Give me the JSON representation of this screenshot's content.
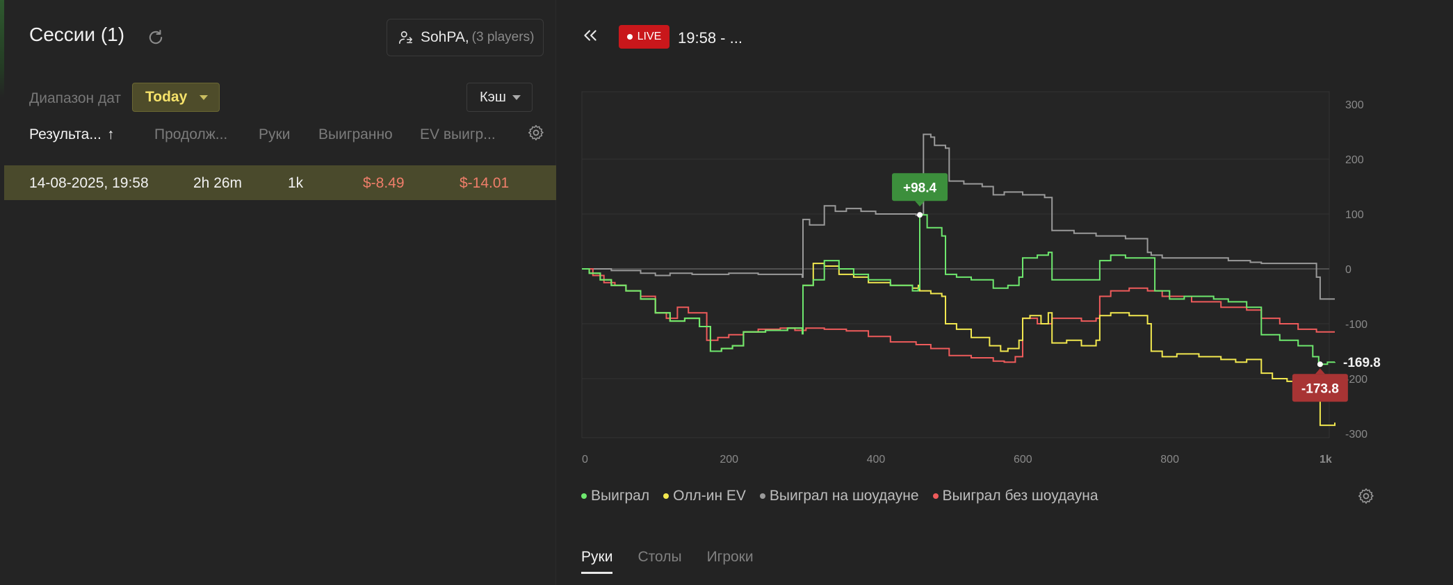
{
  "left_panel": {
    "title": "Сессии (1)",
    "player_name": "SohPA,",
    "player_count": "(3 players)",
    "date_range_label": "Диапазон дат",
    "date_range_value": "Today",
    "game_type": "Кэш",
    "columns": [
      "Результа...",
      "Продолж...",
      "Руки",
      "Выигранно",
      "EV выигр..."
    ],
    "sort_indicator": "↑",
    "rows": [
      {
        "date": "14-08-2025, 19:58",
        "duration": "2h 26m",
        "hands": "1k",
        "won": "$-8.49",
        "ev_won": "$-14.01"
      }
    ]
  },
  "right_panel": {
    "live_label": "LIVE",
    "session_title": "19:58 - ...",
    "legend": [
      {
        "label": "Выиграл",
        "color": "#6ee86e"
      },
      {
        "label": "Олл-ин EV",
        "color": "#f2e84f"
      },
      {
        "label": "Выиграл на шоудауне",
        "color": "#9a9a9a"
      },
      {
        "label": "Выиграл без шоудауна",
        "color": "#ef5b5b"
      }
    ],
    "tabs": [
      "Руки",
      "Столы",
      "Игроки"
    ],
    "active_tab": "Руки"
  },
  "chart_data": {
    "type": "line",
    "xlim": [
      0,
      1025
    ],
    "ylim": [
      -300,
      300
    ],
    "x_ticks": [
      "0",
      "200",
      "400",
      "600",
      "800",
      "1k"
    ],
    "y_ticks": [
      "300",
      "200",
      "100",
      "0",
      "-100",
      "-200",
      "-300"
    ],
    "grid": true,
    "legend_position": "bottom",
    "annotations": [
      {
        "label": "+98.4",
        "x": 460,
        "y": 98.4,
        "color": "#3c8f3c"
      },
      {
        "label": "-173.8",
        "x": 1005,
        "y": -173.8,
        "color": "#a83434"
      },
      {
        "label": "-169.8",
        "x": 1025,
        "y": -169.8,
        "color": "none"
      }
    ],
    "series": [
      {
        "name": "Выиграл",
        "color": "#6ee86e",
        "points": [
          [
            0,
            0
          ],
          [
            10,
            -8
          ],
          [
            25,
            -20
          ],
          [
            40,
            -30
          ],
          [
            60,
            -40
          ],
          [
            80,
            -55
          ],
          [
            100,
            -80
          ],
          [
            120,
            -95
          ],
          [
            140,
            -90
          ],
          [
            160,
            -105
          ],
          [
            175,
            -150
          ],
          [
            190,
            -145
          ],
          [
            205,
            -140
          ],
          [
            220,
            -115
          ],
          [
            250,
            -112
          ],
          [
            280,
            -108
          ],
          [
            300,
            -118
          ],
          [
            301,
            -30
          ],
          [
            315,
            -20
          ],
          [
            330,
            15
          ],
          [
            350,
            0
          ],
          [
            370,
            -10
          ],
          [
            390,
            -20
          ],
          [
            420,
            -30
          ],
          [
            450,
            -40
          ],
          [
            458,
            -35
          ],
          [
            460,
            98.4
          ],
          [
            470,
            75
          ],
          [
            490,
            60
          ],
          [
            495,
            -10
          ],
          [
            510,
            -15
          ],
          [
            530,
            -20
          ],
          [
            560,
            -35
          ],
          [
            580,
            -30
          ],
          [
            595,
            -15
          ],
          [
            600,
            20
          ],
          [
            620,
            25
          ],
          [
            635,
            30
          ],
          [
            640,
            -20
          ],
          [
            670,
            -20
          ],
          [
            700,
            -20
          ],
          [
            705,
            15
          ],
          [
            720,
            25
          ],
          [
            740,
            20
          ],
          [
            770,
            20
          ],
          [
            780,
            -40
          ],
          [
            800,
            -55
          ],
          [
            820,
            -50
          ],
          [
            860,
            -55
          ],
          [
            880,
            -60
          ],
          [
            905,
            -70
          ],
          [
            925,
            -120
          ],
          [
            950,
            -130
          ],
          [
            975,
            -140
          ],
          [
            995,
            -160
          ],
          [
            1003,
            -173.8
          ],
          [
            1015,
            -170
          ],
          [
            1025,
            -169.8
          ]
        ]
      },
      {
        "name": "Олл-ин EV",
        "color": "#f2e84f",
        "points": [
          [
            0,
            0
          ],
          [
            10,
            -8
          ],
          [
            25,
            -20
          ],
          [
            40,
            -30
          ],
          [
            60,
            -40
          ],
          [
            80,
            -55
          ],
          [
            100,
            -80
          ],
          [
            120,
            -95
          ],
          [
            140,
            -90
          ],
          [
            160,
            -105
          ],
          [
            175,
            -150
          ],
          [
            190,
            -145
          ],
          [
            205,
            -140
          ],
          [
            220,
            -115
          ],
          [
            250,
            -112
          ],
          [
            280,
            -108
          ],
          [
            300,
            -118
          ],
          [
            301,
            -30
          ],
          [
            315,
            10
          ],
          [
            330,
            5
          ],
          [
            350,
            -10
          ],
          [
            370,
            -15
          ],
          [
            390,
            -25
          ],
          [
            420,
            -30
          ],
          [
            450,
            -35
          ],
          [
            458,
            -30
          ],
          [
            460,
            -40
          ],
          [
            475,
            -45
          ],
          [
            490,
            -50
          ],
          [
            495,
            -100
          ],
          [
            510,
            -110
          ],
          [
            530,
            -125
          ],
          [
            555,
            -140
          ],
          [
            570,
            -150
          ],
          [
            580,
            -145
          ],
          [
            595,
            -130
          ],
          [
            600,
            -90
          ],
          [
            610,
            -85
          ],
          [
            625,
            -100
          ],
          [
            635,
            -80
          ],
          [
            640,
            -135
          ],
          [
            660,
            -130
          ],
          [
            680,
            -140
          ],
          [
            700,
            -130
          ],
          [
            705,
            -85
          ],
          [
            720,
            -80
          ],
          [
            745,
            -85
          ],
          [
            770,
            -100
          ],
          [
            775,
            -150
          ],
          [
            790,
            -160
          ],
          [
            810,
            -155
          ],
          [
            840,
            -160
          ],
          [
            870,
            -165
          ],
          [
            890,
            -170
          ],
          [
            905,
            -165
          ],
          [
            925,
            -190
          ],
          [
            940,
            -200
          ],
          [
            960,
            -205
          ],
          [
            975,
            -210
          ],
          [
            1000,
            -240
          ],
          [
            1005,
            -285
          ],
          [
            1025,
            -280
          ]
        ]
      },
      {
        "name": "Выиграл на шоудауне",
        "color": "#9a9a9a",
        "points": [
          [
            0,
            0
          ],
          [
            40,
            -3
          ],
          [
            80,
            -8
          ],
          [
            100,
            -12
          ],
          [
            120,
            -8
          ],
          [
            150,
            -10
          ],
          [
            200,
            -8
          ],
          [
            240,
            -10
          ],
          [
            260,
            -10
          ],
          [
            300,
            -15
          ],
          [
            301,
            90
          ],
          [
            310,
            80
          ],
          [
            330,
            115
          ],
          [
            345,
            105
          ],
          [
            360,
            110
          ],
          [
            380,
            105
          ],
          [
            400,
            100
          ],
          [
            420,
            100
          ],
          [
            455,
            98
          ],
          [
            460,
            100
          ],
          [
            465,
            245
          ],
          [
            475,
            240
          ],
          [
            480,
            225
          ],
          [
            495,
            220
          ],
          [
            500,
            160
          ],
          [
            520,
            155
          ],
          [
            545,
            150
          ],
          [
            560,
            135
          ],
          [
            575,
            140
          ],
          [
            600,
            135
          ],
          [
            630,
            130
          ],
          [
            640,
            70
          ],
          [
            670,
            65
          ],
          [
            700,
            60
          ],
          [
            740,
            55
          ],
          [
            760,
            55
          ],
          [
            770,
            30
          ],
          [
            775,
            25
          ],
          [
            790,
            20
          ],
          [
            840,
            20
          ],
          [
            880,
            15
          ],
          [
            910,
            12
          ],
          [
            925,
            10
          ],
          [
            975,
            10
          ],
          [
            1000,
            -15
          ],
          [
            1005,
            -55
          ],
          [
            1025,
            -55
          ]
        ]
      },
      {
        "name": "Выиграл без шоудауна",
        "color": "#ef5b5b",
        "points": [
          [
            0,
            0
          ],
          [
            15,
            -12
          ],
          [
            30,
            -25
          ],
          [
            45,
            -30
          ],
          [
            60,
            -40
          ],
          [
            80,
            -50
          ],
          [
            100,
            -80
          ],
          [
            115,
            -90
          ],
          [
            130,
            -70
          ],
          [
            145,
            -80
          ],
          [
            170,
            -130
          ],
          [
            185,
            -125
          ],
          [
            200,
            -120
          ],
          [
            220,
            -115
          ],
          [
            240,
            -110
          ],
          [
            270,
            -108
          ],
          [
            290,
            -112
          ],
          [
            305,
            -108
          ],
          [
            330,
            -110
          ],
          [
            360,
            -113
          ],
          [
            390,
            -123
          ],
          [
            420,
            -133
          ],
          [
            455,
            -138
          ],
          [
            475,
            -145
          ],
          [
            500,
            -158
          ],
          [
            530,
            -162
          ],
          [
            560,
            -168
          ],
          [
            575,
            -170
          ],
          [
            590,
            -160
          ],
          [
            600,
            -90
          ],
          [
            620,
            -100
          ],
          [
            640,
            -90
          ],
          [
            680,
            -95
          ],
          [
            700,
            -90
          ],
          [
            705,
            -50
          ],
          [
            720,
            -40
          ],
          [
            745,
            -35
          ],
          [
            770,
            -40
          ],
          [
            790,
            -50
          ],
          [
            830,
            -60
          ],
          [
            870,
            -70
          ],
          [
            905,
            -75
          ],
          [
            925,
            -90
          ],
          [
            950,
            -100
          ],
          [
            975,
            -110
          ],
          [
            1000,
            -115
          ],
          [
            1025,
            -115
          ]
        ]
      }
    ]
  }
}
